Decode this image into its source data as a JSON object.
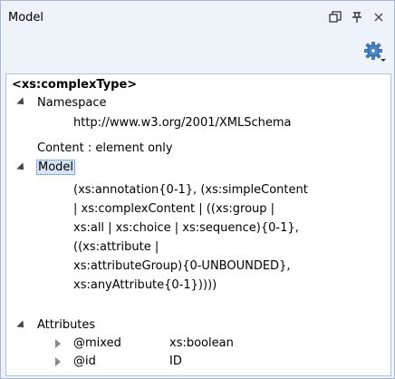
{
  "header": {
    "title": "Model"
  },
  "tree": {
    "root_label": "<xs:complexType>",
    "namespace": {
      "label": "Namespace",
      "value": "http://www.w3.org/2001/XMLSchema"
    },
    "content_label": "Content : element only",
    "model": {
      "label": "Model",
      "lines": [
        "(xs:annotation{0-1}, (xs:simpleContent",
        "| xs:complexContent | ((xs:group |",
        "xs:all | xs:choice | xs:sequence){0-1},",
        "((xs:attribute |",
        "xs:attributeGroup){0-UNBOUNDED},",
        "xs:anyAttribute{0-1}))))"
      ]
    },
    "attributes": {
      "label": "Attributes",
      "items": [
        {
          "name": "@mixed",
          "type": "xs:boolean"
        },
        {
          "name": "@id",
          "type": "ID"
        }
      ]
    }
  }
}
